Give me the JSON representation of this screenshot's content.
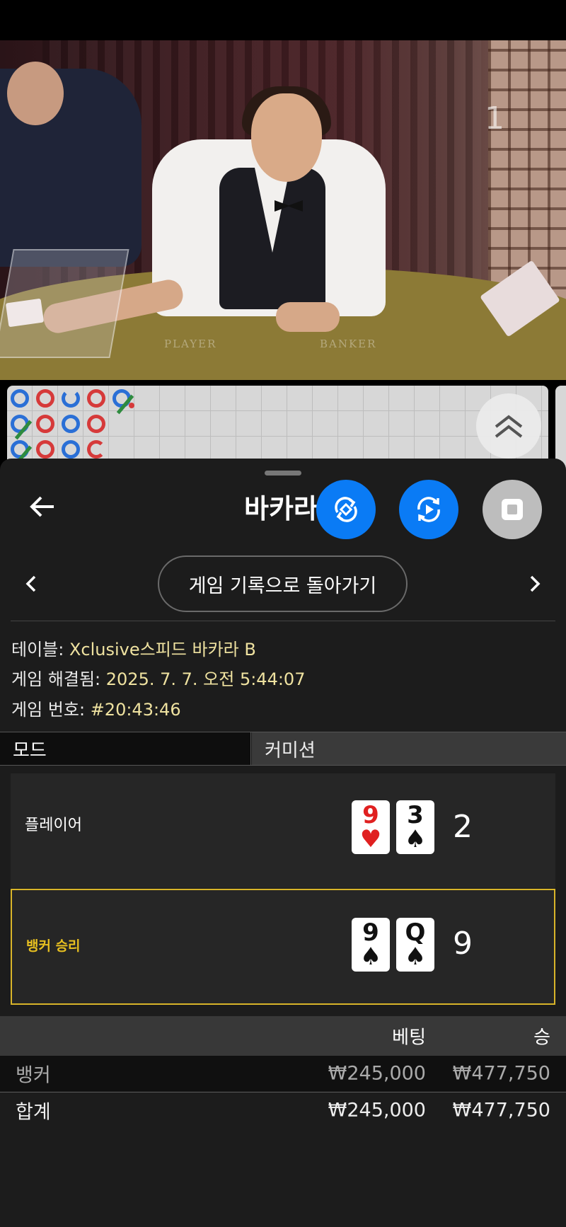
{
  "video": {
    "table_player_label": "PLAYER",
    "table_banker_label": "BANKER",
    "round_indicator": "1"
  },
  "roadmap": {
    "columns": [
      [
        "blue",
        "blue-green",
        "blue-green"
      ],
      [
        "red",
        "red",
        "red"
      ],
      [
        "blue",
        "blue",
        "blue"
      ],
      [
        "red",
        "red",
        "red"
      ],
      [
        "blue-green"
      ]
    ]
  },
  "header": {
    "title": "바카라",
    "back_icon": "arrow-left-icon",
    "buttons": [
      {
        "name": "rotate-icon",
        "color": "#0a7bf5"
      },
      {
        "name": "replay-icon",
        "color": "#0a7bf5"
      },
      {
        "name": "stop-icon",
        "color": "#bdbdbd"
      }
    ]
  },
  "nav": {
    "return_label": "게임 기록으로 돌아가기"
  },
  "details": {
    "table_label": "테이블:",
    "table_value": "Xclusive스피드 바카라 B",
    "resolved_label": "게임 해결됨:",
    "resolved_value": "2025. 7. 7. 오전 5:44:07",
    "number_label": "게임 번호:",
    "number_value": "#20:43:46"
  },
  "tabs": {
    "mode": "모드",
    "commission": "커미션"
  },
  "hands": {
    "player": {
      "label": "플레이어",
      "cards": [
        {
          "rank": "9",
          "suit": "♥",
          "color": "red"
        },
        {
          "rank": "3",
          "suit": "♠",
          "color": "black"
        }
      ],
      "score": "2"
    },
    "banker": {
      "label": "뱅커 승리",
      "label_color": "#e8c020",
      "cards": [
        {
          "rank": "9",
          "suit": "♠",
          "color": "black"
        },
        {
          "rank": "Q",
          "suit": "♠",
          "color": "black"
        }
      ],
      "score": "9"
    }
  },
  "bets": {
    "header_bet": "베팅",
    "header_win": "승",
    "rows": [
      {
        "label": "뱅커",
        "bet": "₩245,000",
        "win": "₩477,750"
      }
    ],
    "total": {
      "label": "합계",
      "bet": "₩245,000",
      "win": "₩477,750"
    }
  }
}
